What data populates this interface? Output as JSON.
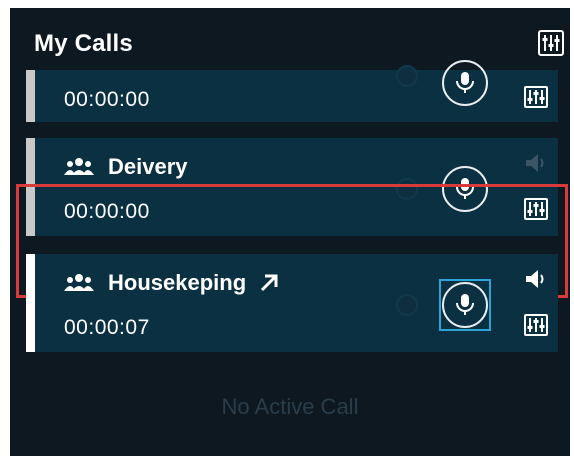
{
  "header": {
    "title": "My Calls",
    "mixer_icon": "mixer-icon"
  },
  "calls": [
    {
      "name": "",
      "timer": "00:00:00",
      "speaker_active": false,
      "selected": false
    },
    {
      "name": "Deivery",
      "timer": "00:00:00",
      "speaker_active": false,
      "selected": false
    },
    {
      "name": "Housekeping",
      "timer": "00:00:07",
      "speaker_active": true,
      "selected": true,
      "external_link": true
    }
  ],
  "empty_state": {
    "text": "No Active Call"
  },
  "colors": {
    "panel_bg": "#0d1821",
    "card_bg": "#0b3042",
    "accent_grey": "#c9c9c9",
    "accent_white": "#ffffff",
    "selection_red": "#d93b3b",
    "focus_blue": "#2ea3d6"
  }
}
